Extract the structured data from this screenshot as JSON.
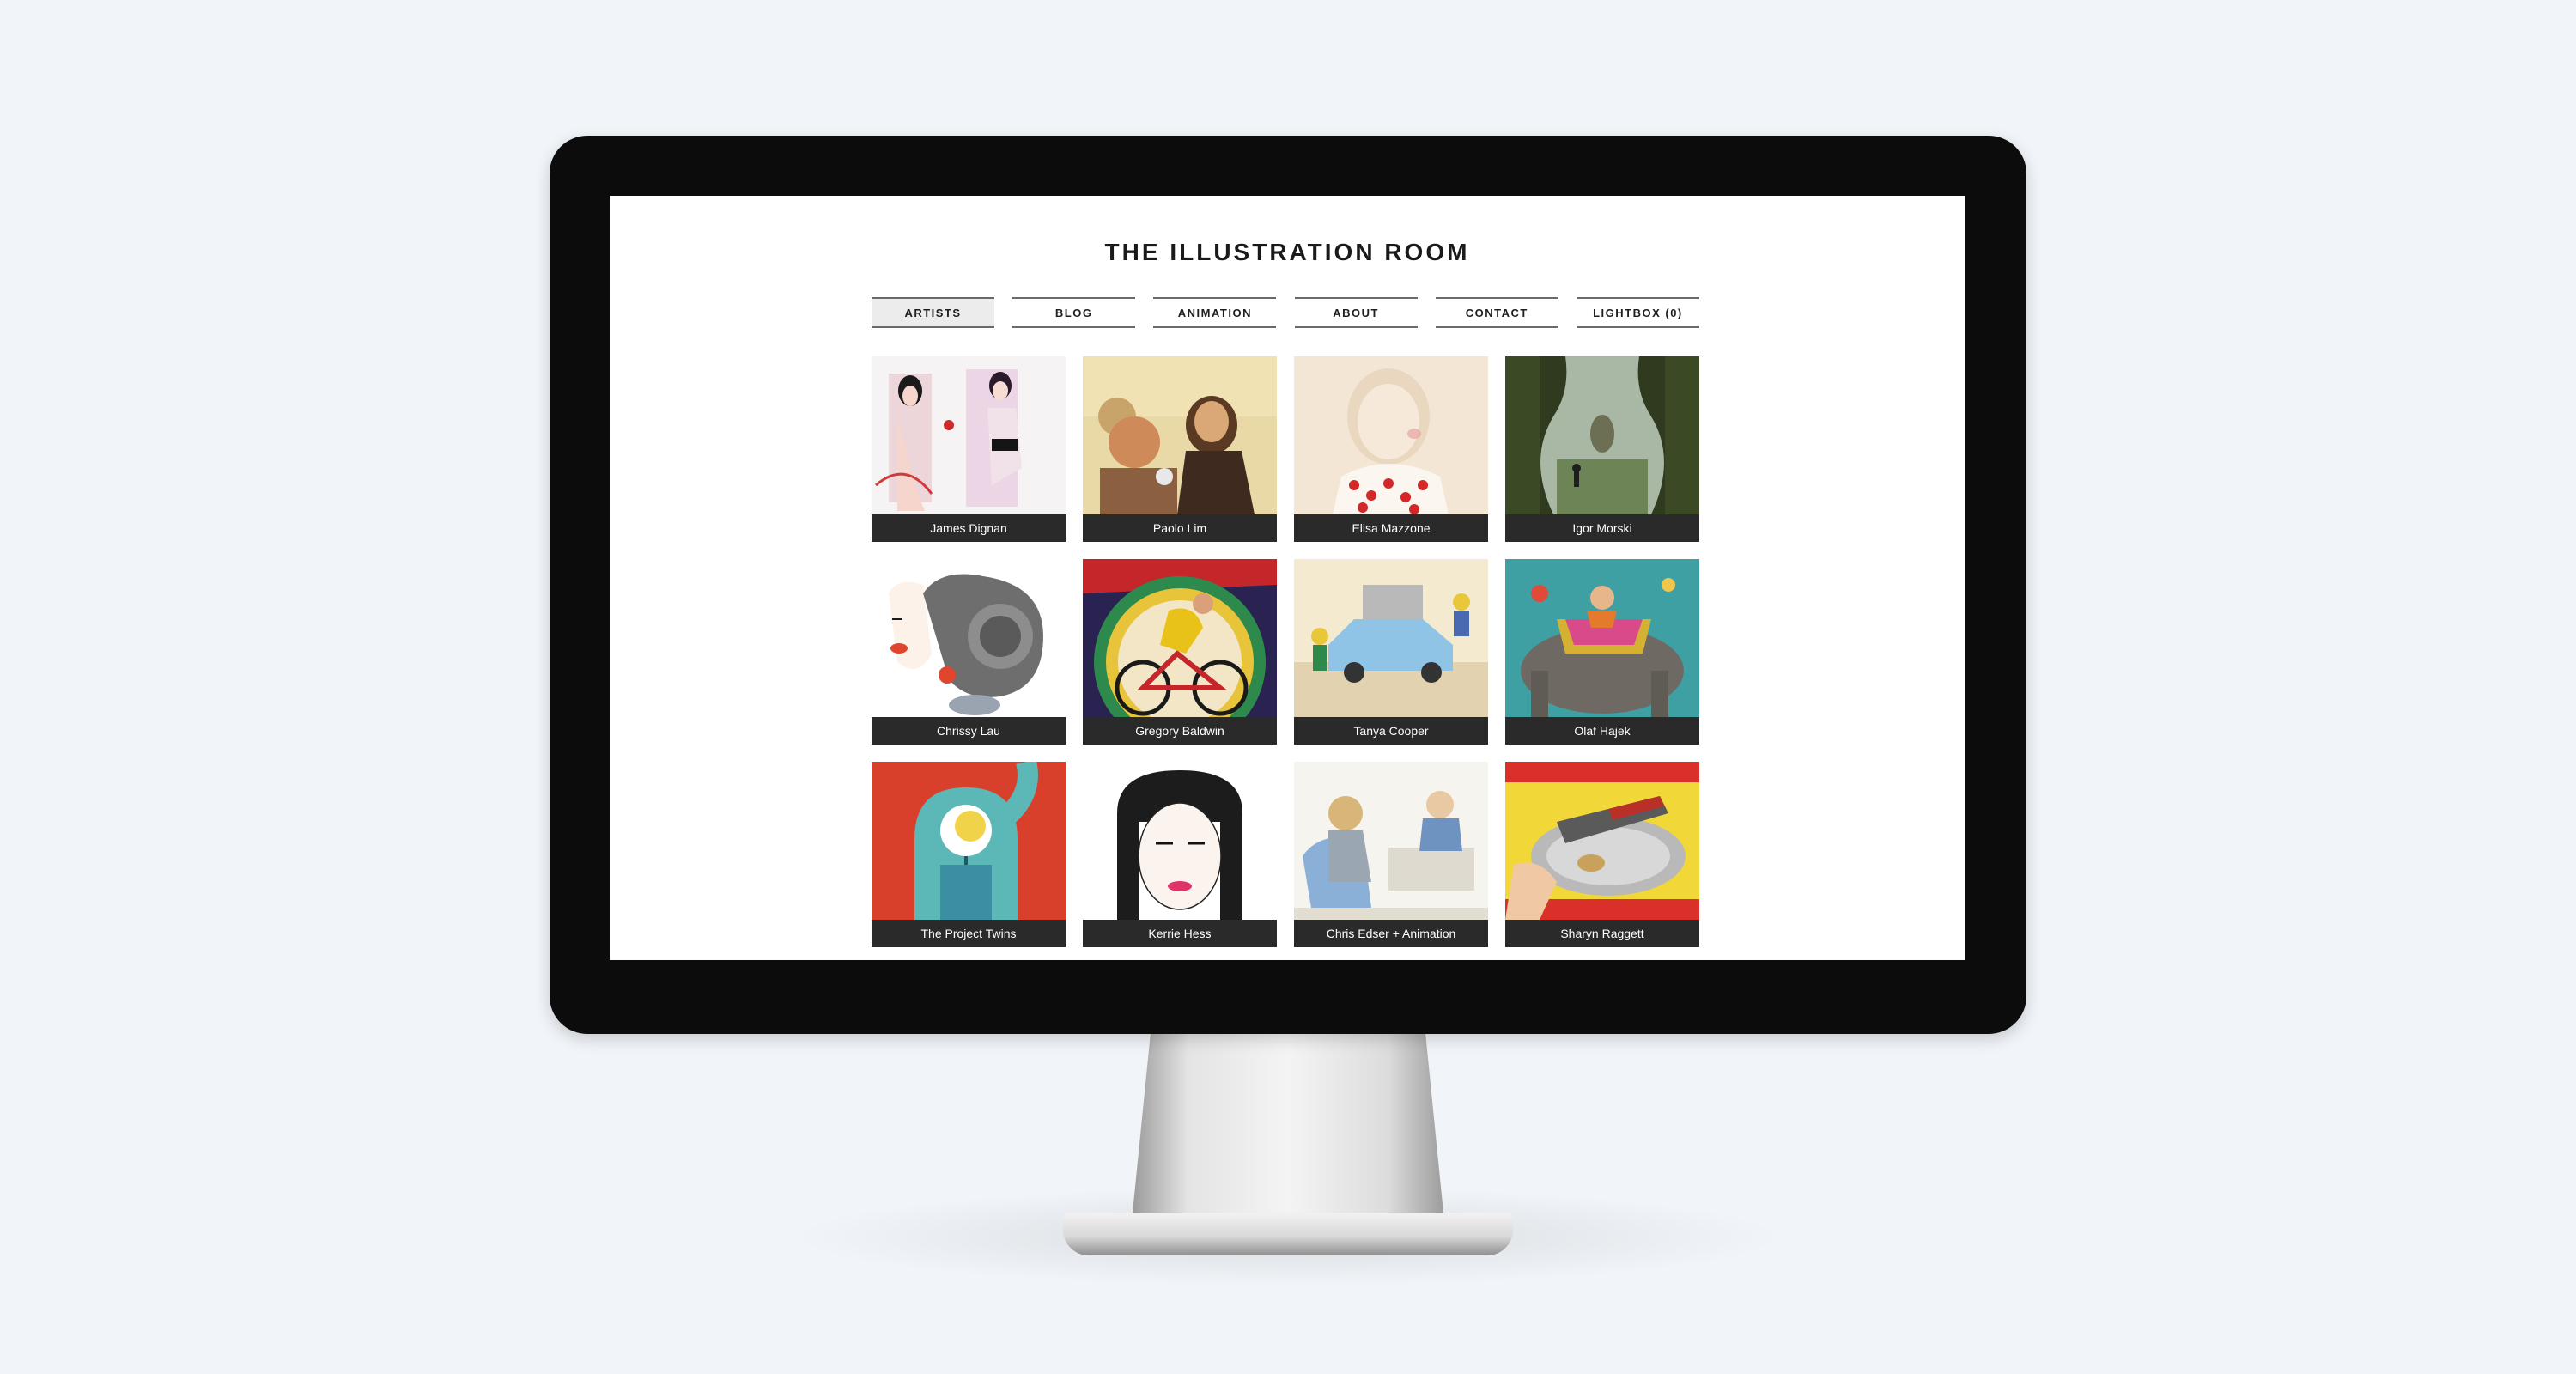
{
  "site": {
    "title": "THE ILLUSTRATION ROOM"
  },
  "nav": [
    {
      "label": "ARTISTS",
      "active": true
    },
    {
      "label": "BLOG"
    },
    {
      "label": "ANIMATION"
    },
    {
      "label": "ABOUT"
    },
    {
      "label": "CONTACT"
    },
    {
      "label": "LIGHTBOX (0)"
    }
  ],
  "artists": [
    {
      "name": "James Dignan"
    },
    {
      "name": "Paolo Lim"
    },
    {
      "name": "Elisa Mazzone"
    },
    {
      "name": "Igor Morski"
    },
    {
      "name": "Chrissy Lau"
    },
    {
      "name": "Gregory Baldwin"
    },
    {
      "name": "Tanya Cooper"
    },
    {
      "name": "Olaf Hajek"
    },
    {
      "name": "The Project Twins"
    },
    {
      "name": "Kerrie Hess"
    },
    {
      "name": "Chris Edser + Animation"
    },
    {
      "name": "Sharyn Raggett"
    }
  ],
  "colors": {
    "background": "#f1f5f9",
    "bezel": "#0c0c0c",
    "caption_bar": "#2a2a2a"
  }
}
